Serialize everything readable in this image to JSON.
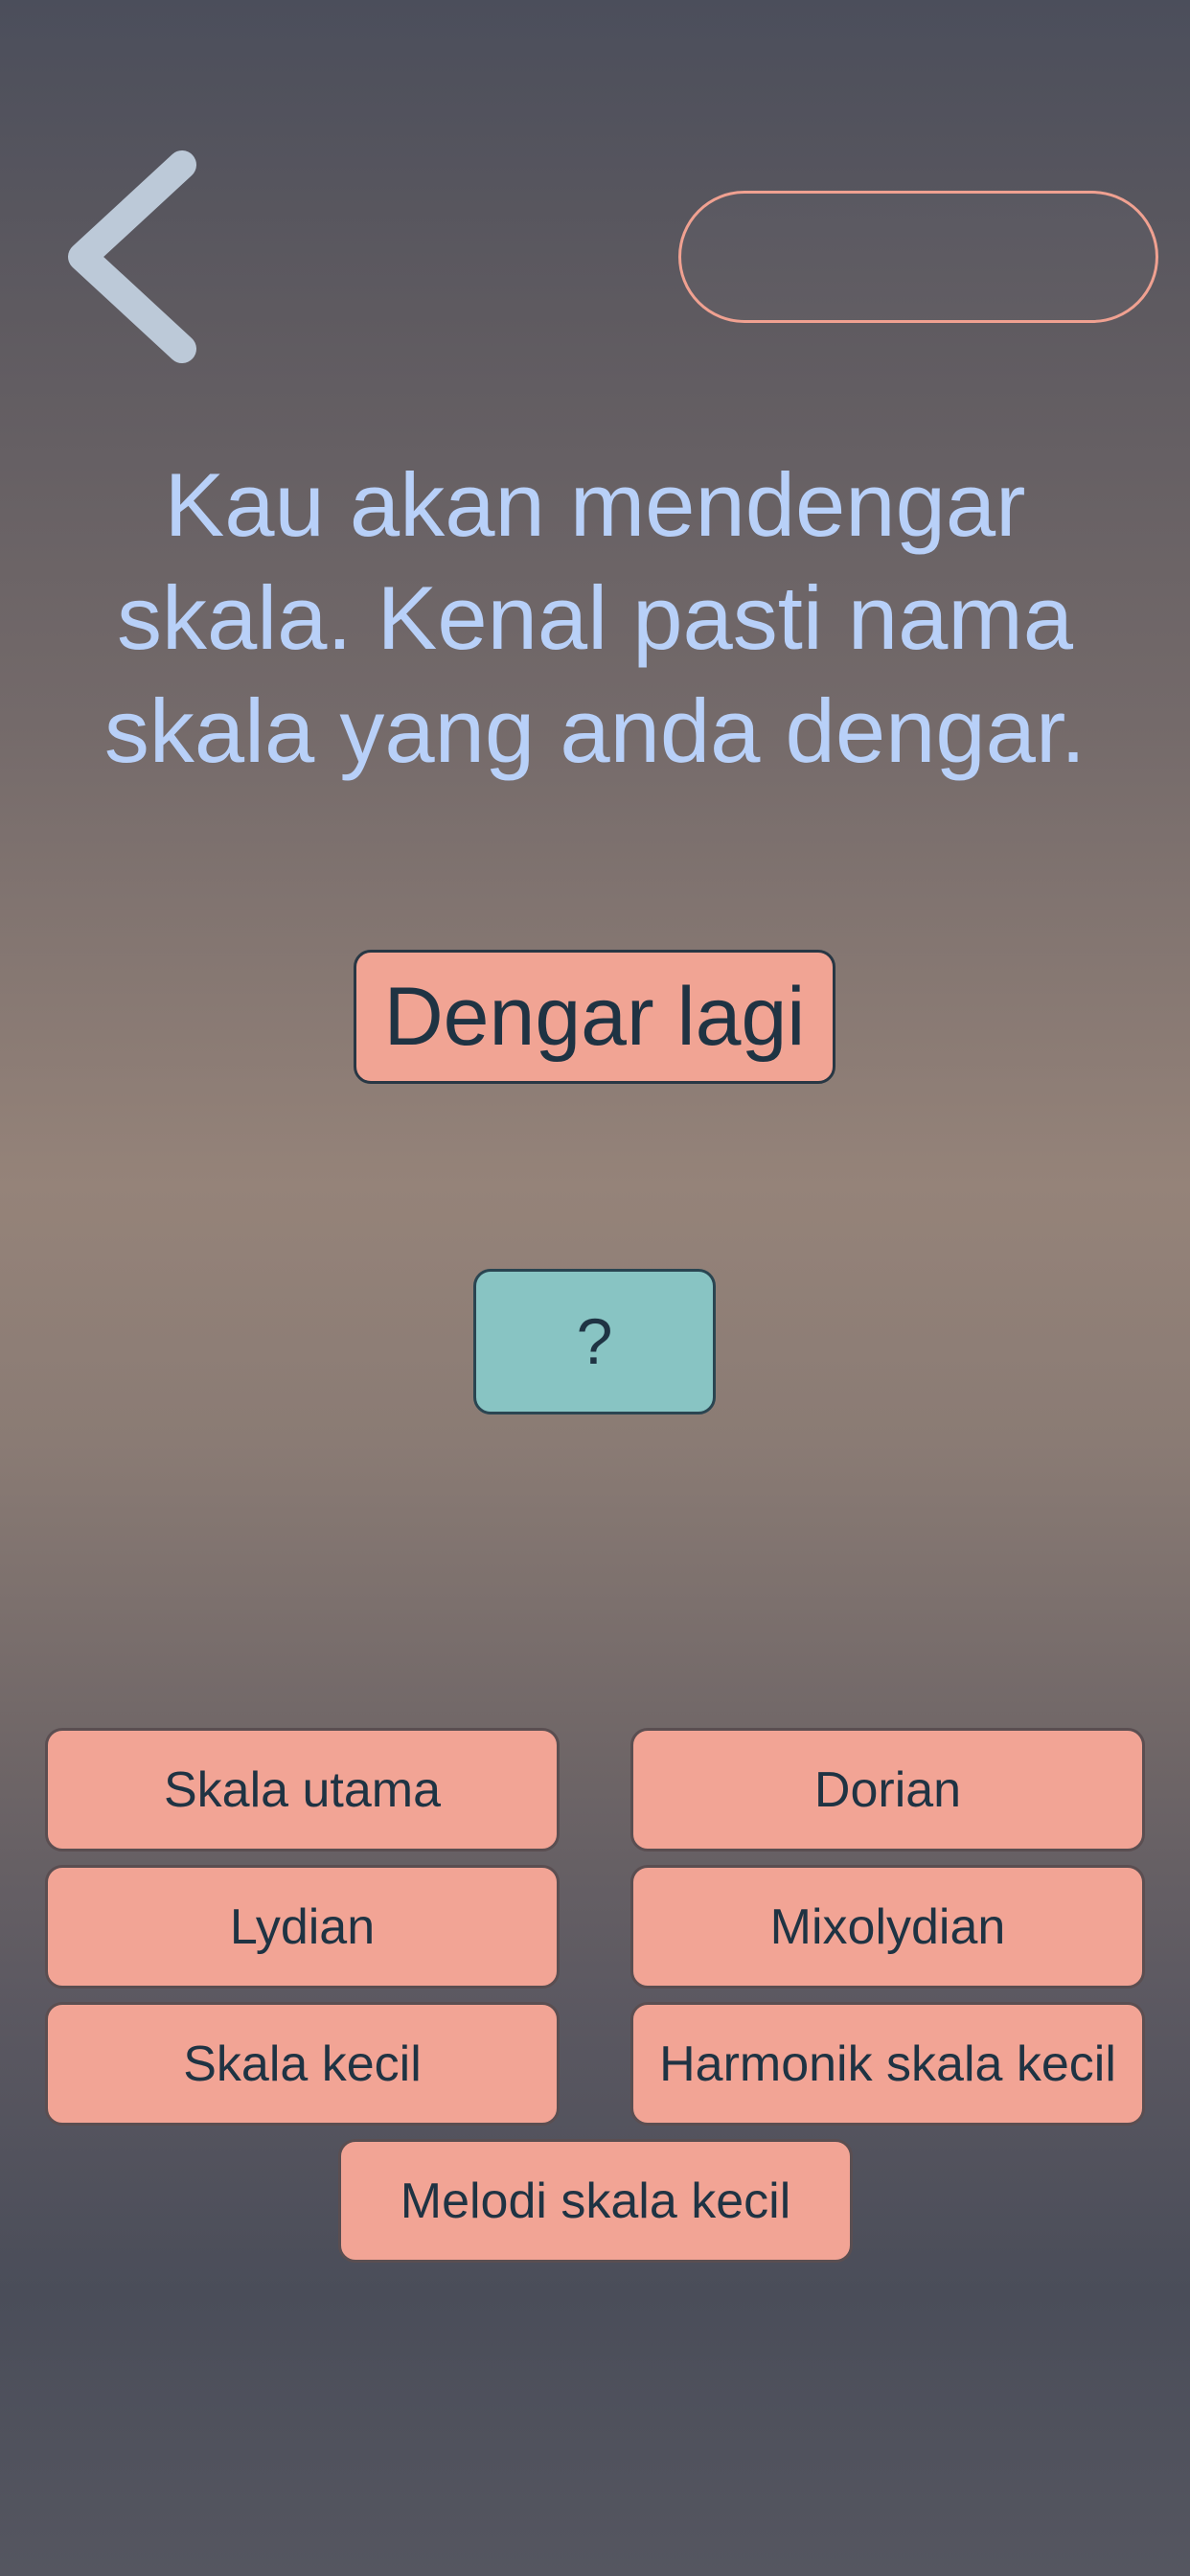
{
  "header": {
    "back_icon": "chevron-left-icon",
    "top_pill_text": ""
  },
  "prompt": {
    "line_1": "Kau akan mendengar",
    "line_2": "skala. Kenal pasti nama",
    "line_3": "skala yang anda dengar."
  },
  "controls": {
    "listen_again_label": "Dengar lagi",
    "answer_placeholder": "?"
  },
  "options": [
    {
      "label": "Skala utama"
    },
    {
      "label": "Dorian"
    },
    {
      "label": "Lydian"
    },
    {
      "label": "Mixolydian"
    },
    {
      "label": "Skala kecil"
    },
    {
      "label": "Harmonik skala kecil"
    },
    {
      "label": "Melodi skala kecil"
    }
  ],
  "colors": {
    "accent": "#f2a495",
    "answer_box": "#88c4c3",
    "prompt_text": "#b8d0f8",
    "button_text": "#1f3343"
  }
}
